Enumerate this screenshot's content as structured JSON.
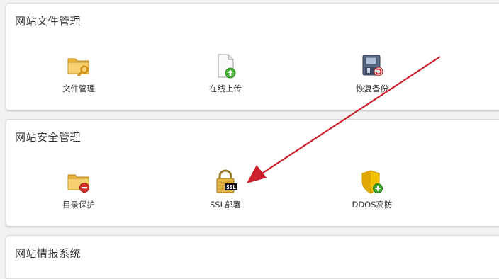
{
  "sections": [
    {
      "title": "网站文件管理",
      "items": [
        {
          "label": "文件管理",
          "icon": "folder-key-icon"
        },
        {
          "label": "在线上传",
          "icon": "upload-file-icon"
        },
        {
          "label": "恢复备份",
          "icon": "restore-backup-icon"
        }
      ]
    },
    {
      "title": "网站安全管理",
      "items": [
        {
          "label": "目录保护",
          "icon": "folder-lock-icon",
          "badge": ""
        },
        {
          "label": "SSL部署",
          "icon": "ssl-lock-icon",
          "badge": "SSL"
        },
        {
          "label": "DDOS高防",
          "icon": "shield-add-icon",
          "badge": ""
        }
      ]
    },
    {
      "title": "网站情报系统"
    }
  ],
  "colors": {
    "annotation_arrow": "#cc1f2b",
    "folder": "#f0c040",
    "shield": "#f2c200",
    "badge_green": "#3aa52b",
    "badge_red": "#d9322a"
  }
}
